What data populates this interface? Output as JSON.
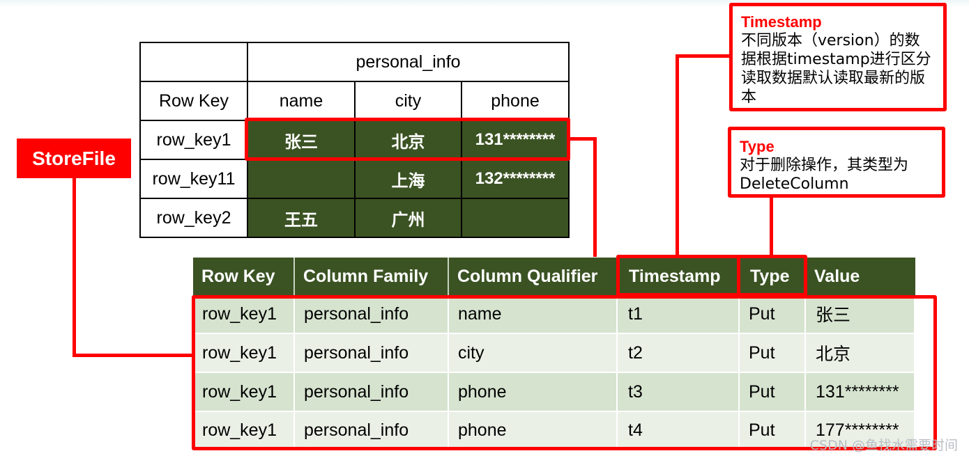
{
  "top_table": {
    "column_family": "personal_info",
    "headers": [
      "Row Key",
      "name",
      "city",
      "phone"
    ],
    "rows": [
      {
        "row_key": "row_key1",
        "name": "张三",
        "city": "北京",
        "phone": "131********"
      },
      {
        "row_key": "row_key11",
        "name": "",
        "city": "上海",
        "phone": "132********"
      },
      {
        "row_key": "row_key2",
        "name": "王五",
        "city": "广州",
        "phone": ""
      }
    ]
  },
  "storefile_label": "StoreFile",
  "bottom_table": {
    "headers": [
      "Row Key",
      "Column Family",
      "Column Qualifier",
      "Timestamp",
      "Type",
      "Value"
    ],
    "rows": [
      [
        "row_key1",
        "personal_info",
        "name",
        "t1",
        "Put",
        "张三"
      ],
      [
        "row_key1",
        "personal_info",
        "city",
        "t2",
        "Put",
        "北京"
      ],
      [
        "row_key1",
        "personal_info",
        "phone",
        "t3",
        "Put",
        "131********"
      ],
      [
        "row_key1",
        "personal_info",
        "phone",
        "t4",
        "Put",
        "177********"
      ]
    ]
  },
  "callouts": {
    "timestamp": {
      "title": "Timestamp",
      "lines": [
        "不同版本（version）的数",
        "据根据timestamp进行区分",
        "读取数据默认读取最新的版",
        "本"
      ]
    },
    "type": {
      "title": "Type",
      "lines": [
        "对于删除操作，其类型为",
        "DeleteColumn"
      ]
    }
  },
  "colors": {
    "header_green": "#3b5323",
    "row_light": "#d6e3cf",
    "row_lighter": "#eaf0e6",
    "highlight_red": "#ff0000"
  },
  "watermark": "CSDN @鱼找水需要时间"
}
